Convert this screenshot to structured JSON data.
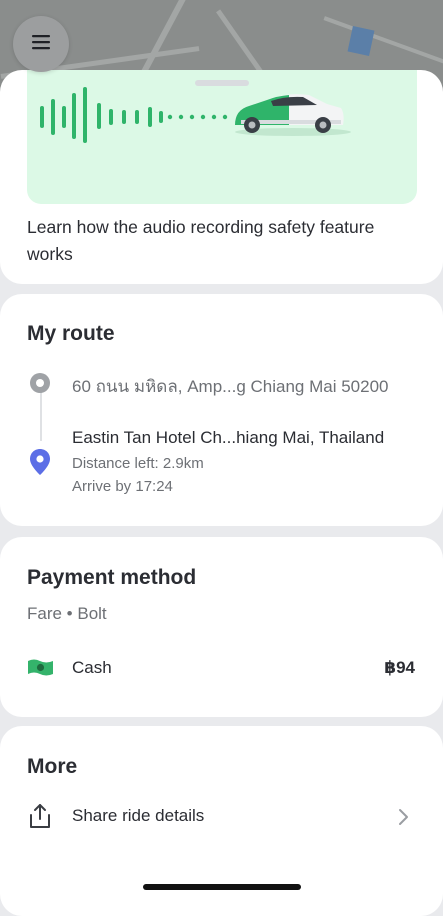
{
  "banner": {
    "learn_text": "Learn how the audio recording safety feature works",
    "accent_color": "#2fb46a"
  },
  "route": {
    "title": "My route",
    "origin": "60 ถนน มหิดล, Amp...g Chiang Mai 50200",
    "destination": "Eastin Tan Hotel Ch...hiang Mai, Thailand",
    "distance_left": "Distance left: 2.9km",
    "arrive_by": "Arrive by 17:24",
    "pin_color": "#5c6ee6"
  },
  "payment": {
    "title": "Payment method",
    "fare_line": "Fare • Bolt",
    "method_label": "Cash",
    "price": "฿94",
    "cash_icon_color": "#34b36b"
  },
  "more": {
    "title": "More",
    "share_label": "Share ride details"
  },
  "icons": {
    "menu": "menu-icon",
    "share": "share-icon",
    "chevron": "chevron-right-icon",
    "pin": "location-pin-icon",
    "cash": "cash-icon"
  }
}
